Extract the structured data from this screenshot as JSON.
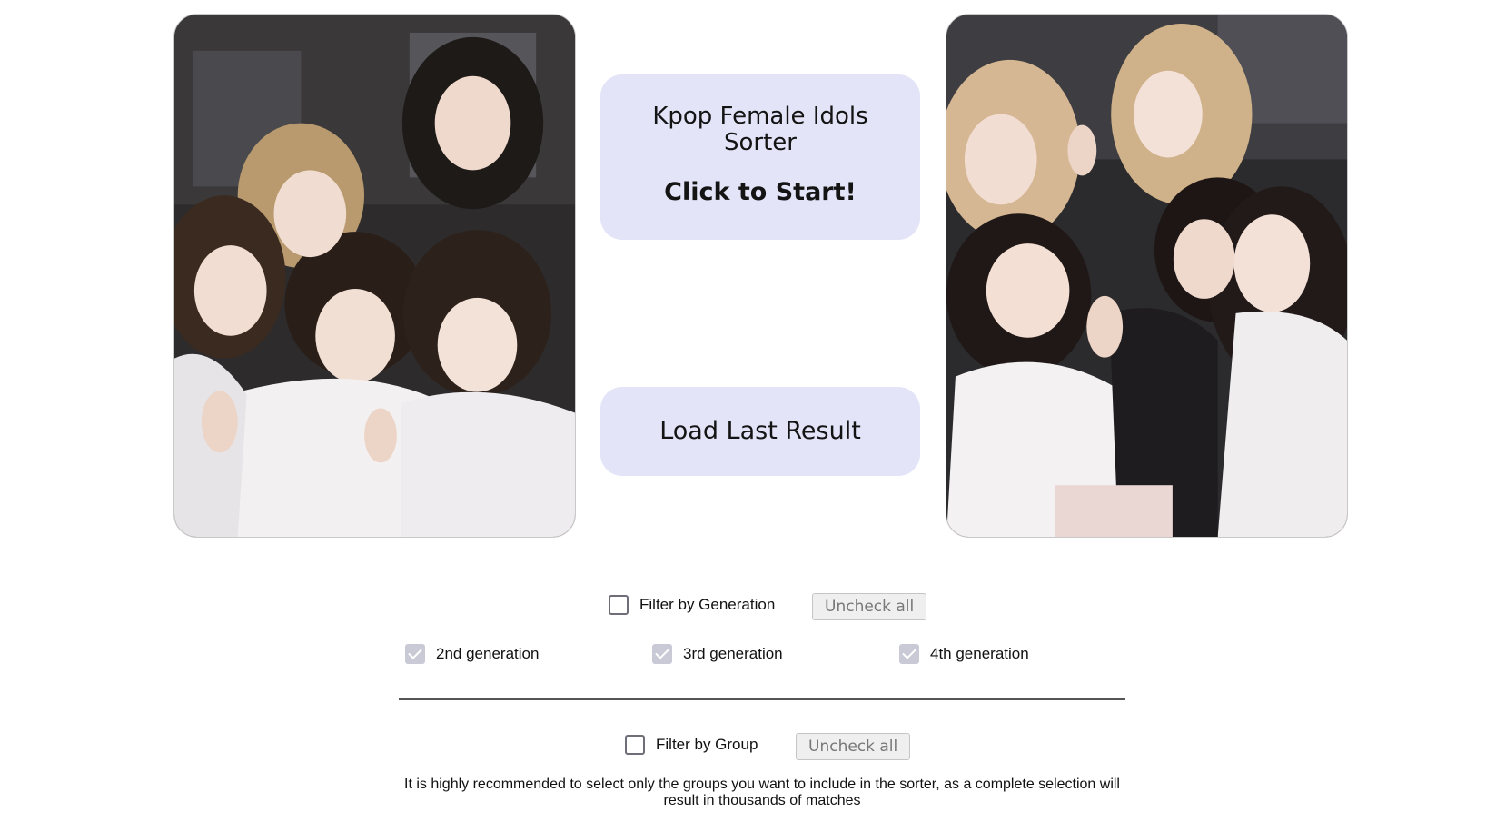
{
  "start_button": {
    "title": "Kpop Female Idols Sorter",
    "cta": "Click to Start!"
  },
  "load_button": {
    "label": "Load Last Result"
  },
  "generation_filter": {
    "label": "Filter by Generation",
    "checked": false,
    "uncheck_all_label": "Uncheck all",
    "options": [
      {
        "label": "2nd generation",
        "checked": true
      },
      {
        "label": "3rd generation",
        "checked": true
      },
      {
        "label": "4th generation",
        "checked": true
      }
    ]
  },
  "group_filter": {
    "label": "Filter by Group",
    "checked": false,
    "uncheck_all_label": "Uncheck all"
  },
  "note": "It is highly recommended to select only the groups you want to include in the sorter, as a complete selection will result in thousands of matches",
  "colors": {
    "button_bg": "#e3e4f8",
    "checkbox_checked": "#c9cad6",
    "divider": "#555555"
  }
}
